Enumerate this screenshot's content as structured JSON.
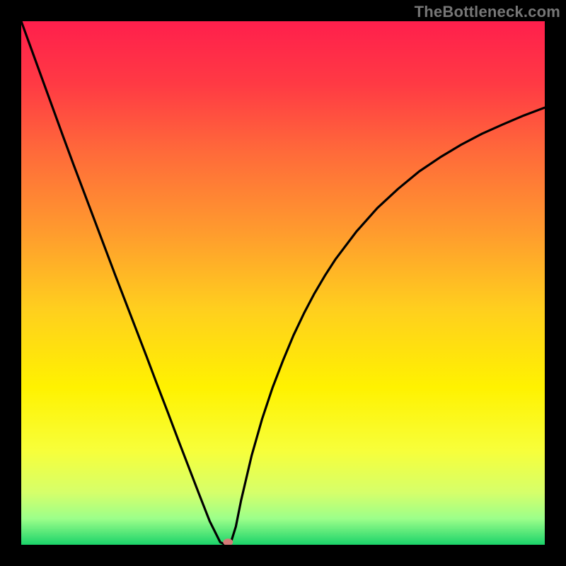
{
  "watermark": "TheBottleneck.com",
  "chart_data": {
    "type": "line",
    "x": [
      0.0,
      0.02,
      0.04,
      0.06,
      0.08,
      0.1,
      0.12,
      0.14,
      0.16,
      0.18,
      0.2,
      0.22,
      0.24,
      0.26,
      0.28,
      0.3,
      0.32,
      0.34,
      0.36,
      0.38,
      0.39,
      0.4,
      0.41,
      0.42,
      0.44,
      0.46,
      0.48,
      0.5,
      0.52,
      0.54,
      0.56,
      0.58,
      0.6,
      0.64,
      0.68,
      0.72,
      0.76,
      0.8,
      0.84,
      0.88,
      0.92,
      0.96,
      1.0
    ],
    "values": [
      1.0,
      0.945,
      0.89,
      0.835,
      0.78,
      0.726,
      0.673,
      0.62,
      0.567,
      0.514,
      0.462,
      0.41,
      0.358,
      0.305,
      0.253,
      0.2,
      0.148,
      0.096,
      0.045,
      0.005,
      0.0,
      0.003,
      0.035,
      0.085,
      0.17,
      0.24,
      0.3,
      0.352,
      0.4,
      0.442,
      0.48,
      0.514,
      0.545,
      0.598,
      0.643,
      0.68,
      0.713,
      0.74,
      0.764,
      0.785,
      0.803,
      0.82,
      0.835
    ],
    "marker": {
      "x": 0.395,
      "y": 0.005
    },
    "xlim": [
      0,
      1
    ],
    "ylim": [
      0,
      1
    ],
    "title": "",
    "xlabel": "",
    "ylabel": "",
    "background_gradient": {
      "stops": [
        {
          "offset": 0.0,
          "color": "#ff1f4c"
        },
        {
          "offset": 0.12,
          "color": "#ff3a44"
        },
        {
          "offset": 0.25,
          "color": "#ff6a3a"
        },
        {
          "offset": 0.4,
          "color": "#ff9a2e"
        },
        {
          "offset": 0.55,
          "color": "#ffcf1e"
        },
        {
          "offset": 0.7,
          "color": "#fff200"
        },
        {
          "offset": 0.82,
          "color": "#f7ff3a"
        },
        {
          "offset": 0.9,
          "color": "#d6ff6a"
        },
        {
          "offset": 0.95,
          "color": "#9cff8a"
        },
        {
          "offset": 1.0,
          "color": "#1bd36a"
        }
      ]
    }
  }
}
